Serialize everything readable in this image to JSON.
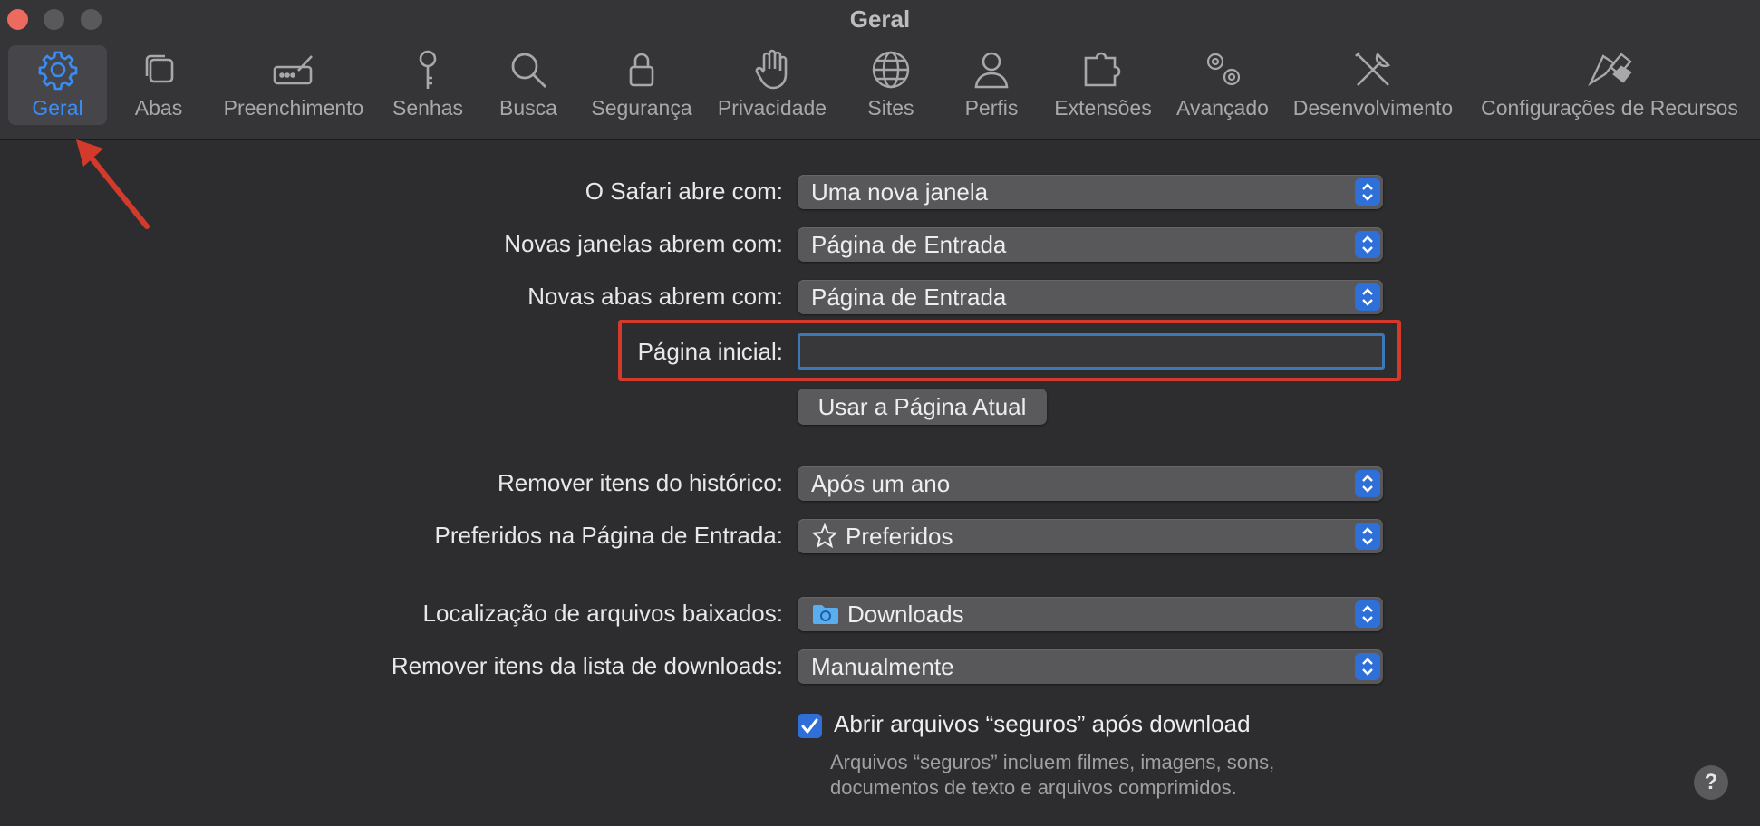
{
  "window": {
    "title": "Geral"
  },
  "toolbar": {
    "tabs": [
      {
        "label": "Geral",
        "icon": "gear-icon",
        "active": true
      },
      {
        "label": "Abas",
        "icon": "tabs-icon"
      },
      {
        "label": "Preenchimento",
        "icon": "autofill-icon"
      },
      {
        "label": "Senhas",
        "icon": "key-icon"
      },
      {
        "label": "Busca",
        "icon": "search-icon"
      },
      {
        "label": "Segurança",
        "icon": "lock-icon"
      },
      {
        "label": "Privacidade",
        "icon": "hand-icon"
      },
      {
        "label": "Sites",
        "icon": "globe-icon"
      },
      {
        "label": "Perfis",
        "icon": "person-icon"
      },
      {
        "label": "Extensões",
        "icon": "puzzle-icon"
      },
      {
        "label": "Avançado",
        "icon": "gears-icon"
      },
      {
        "label": "Desenvolvimento",
        "icon": "tools-icon"
      },
      {
        "label": "Configurações de Recursos",
        "icon": "flags-icon"
      }
    ]
  },
  "settings": {
    "safari_opens_with": {
      "label": "O Safari abre com:",
      "value": "Uma nova janela"
    },
    "new_windows": {
      "label": "Novas janelas abrem com:",
      "value": "Página de Entrada"
    },
    "new_tabs": {
      "label": "Novas abas abrem com:",
      "value": "Página de Entrada"
    },
    "homepage": {
      "label": "Página inicial:",
      "value": ""
    },
    "use_current_page": {
      "label": "Usar a Página Atual"
    },
    "remove_history": {
      "label": "Remover itens do histórico:",
      "value": "Após um ano"
    },
    "favorites": {
      "label": "Preferidos na Página de Entrada:",
      "value": "Preferidos",
      "icon": "star-icon"
    },
    "download_location": {
      "label": "Localização de arquivos baixados:",
      "value": "Downloads",
      "icon": "folder-icon"
    },
    "remove_downloads": {
      "label": "Remover itens da lista de downloads:",
      "value": "Manualmente"
    },
    "open_safe_files": {
      "label": "Abrir arquivos “seguros” após download",
      "checked": true,
      "help_line1": "Arquivos “seguros” incluem filmes, imagens, sons,",
      "help_line2": "documentos de texto e arquivos comprimidos."
    }
  },
  "help_button": {
    "label": "?"
  },
  "colors": {
    "accent": "#2f6fd8",
    "active_tab": "#3a8df5",
    "annotation": "#d33a2c"
  }
}
